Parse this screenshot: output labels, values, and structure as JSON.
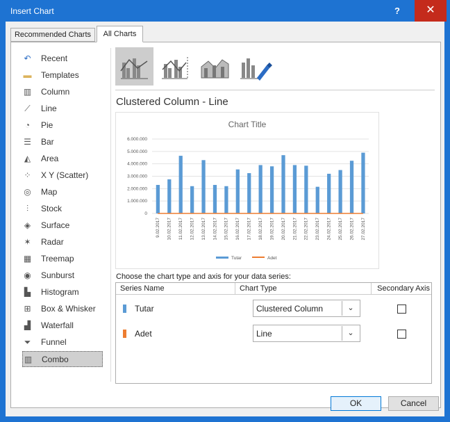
{
  "window": {
    "title": "Insert Chart",
    "help_label": "?",
    "close_label": "✕"
  },
  "tabs": [
    {
      "label": "Recommended Charts"
    },
    {
      "label": "All Charts"
    }
  ],
  "chart_types": [
    {
      "label": "Recent",
      "icon": "recent-icon"
    },
    {
      "label": "Templates",
      "icon": "folder-icon"
    },
    {
      "label": "Column",
      "icon": "column-chart-icon"
    },
    {
      "label": "Line",
      "icon": "line-chart-icon"
    },
    {
      "label": "Pie",
      "icon": "pie-chart-icon"
    },
    {
      "label": "Bar",
      "icon": "bar-chart-icon"
    },
    {
      "label": "Area",
      "icon": "area-chart-icon"
    },
    {
      "label": "X Y (Scatter)",
      "icon": "scatter-chart-icon"
    },
    {
      "label": "Map",
      "icon": "map-chart-icon"
    },
    {
      "label": "Stock",
      "icon": "stock-chart-icon"
    },
    {
      "label": "Surface",
      "icon": "surface-chart-icon"
    },
    {
      "label": "Radar",
      "icon": "radar-chart-icon"
    },
    {
      "label": "Treemap",
      "icon": "treemap-chart-icon"
    },
    {
      "label": "Sunburst",
      "icon": "sunburst-chart-icon"
    },
    {
      "label": "Histogram",
      "icon": "histogram-chart-icon"
    },
    {
      "label": "Box & Whisker",
      "icon": "box-whisker-chart-icon"
    },
    {
      "label": "Waterfall",
      "icon": "waterfall-chart-icon"
    },
    {
      "label": "Funnel",
      "icon": "funnel-chart-icon"
    },
    {
      "label": "Combo",
      "icon": "combo-chart-icon"
    }
  ],
  "selected_type": "Combo",
  "subtype_title": "Clustered Column - Line",
  "series_section": {
    "prompt": "Choose the chart type and axis for your data series:",
    "headers": {
      "name": "Series Name",
      "type": "Chart Type",
      "secondary": "Secondary Axis"
    },
    "rows": [
      {
        "name": "Tutar",
        "chart_type": "Clustered Column",
        "color": "#5b9bd5",
        "secondary": false
      },
      {
        "name": "Adet",
        "chart_type": "Line",
        "color": "#ed7d31",
        "secondary": false
      }
    ]
  },
  "buttons": {
    "ok": "OK",
    "cancel": "Cancel"
  },
  "chart_data": {
    "type": "bar",
    "title": "Chart Title",
    "categories": [
      "9.02.2017",
      "10.02.2017",
      "11.02.2017",
      "12.02.2017",
      "13.02.2017",
      "14.02.2017",
      "15.02.2017",
      "16.02.2017",
      "17.02.2017",
      "18.02.2017",
      "19.02.2017",
      "20.02.2017",
      "21.02.2017",
      "22.02.2017",
      "23.02.2017",
      "24.02.2017",
      "25.02.2017",
      "26.02.2017",
      "27.02.2017"
    ],
    "series": [
      {
        "name": "Tutar",
        "kind": "column",
        "color": "#5b9bd5",
        "values": [
          2300000,
          2750000,
          4650000,
          2200000,
          4300000,
          2300000,
          2200000,
          3550000,
          3250000,
          3900000,
          3800000,
          4700000,
          3900000,
          3850000,
          2150000,
          3200000,
          3500000,
          4250000,
          4900000
        ]
      },
      {
        "name": "Adet",
        "kind": "line",
        "color": "#ed7d31",
        "values": [
          0,
          0,
          0,
          0,
          0,
          0,
          0,
          0,
          0,
          0,
          0,
          0,
          0,
          0,
          0,
          0,
          0,
          0,
          0
        ]
      }
    ],
    "yticks": [
      "0",
      "1.000.000",
      "2.000.000",
      "3.000.000",
      "4.000.000",
      "5.000.000",
      "6.000.000"
    ],
    "ylim": [
      0,
      6000000
    ],
    "legend_position": "bottom"
  }
}
